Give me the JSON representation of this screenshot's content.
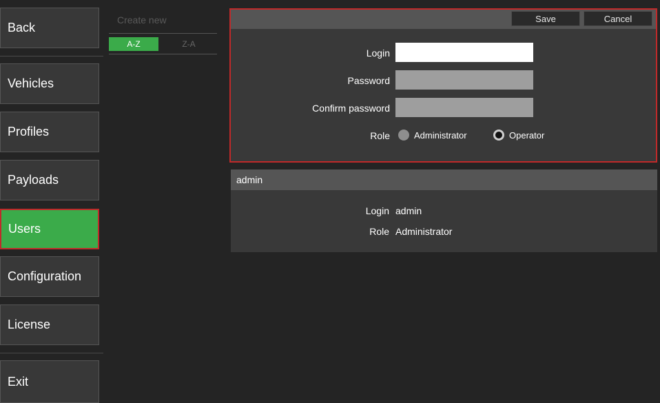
{
  "sidebar": {
    "back": "Back",
    "items": [
      {
        "label": "Vehicles"
      },
      {
        "label": "Profiles"
      },
      {
        "label": "Payloads"
      },
      {
        "label": "Users",
        "active": true
      },
      {
        "label": "Configuration"
      },
      {
        "label": "License"
      }
    ],
    "exit": "Exit"
  },
  "list": {
    "create_new_placeholder": "Create new",
    "sort_az": "A-Z",
    "sort_za": "Z-A"
  },
  "form": {
    "save": "Save",
    "cancel": "Cancel",
    "login_label": "Login",
    "login_value": "",
    "password_label": "Password",
    "confirm_label": "Confirm password",
    "role_label": "Role",
    "roles": [
      {
        "label": "Administrator",
        "selected": false
      },
      {
        "label": "Operator",
        "selected": true
      }
    ]
  },
  "user_card": {
    "name": "admin",
    "login_label": "Login",
    "login_value": "admin",
    "role_label": "Role",
    "role_value": "Administrator"
  },
  "colors": {
    "accent": "#3bab4a",
    "highlight": "#c02a2a",
    "background": "#242424",
    "panel": "#393939"
  }
}
